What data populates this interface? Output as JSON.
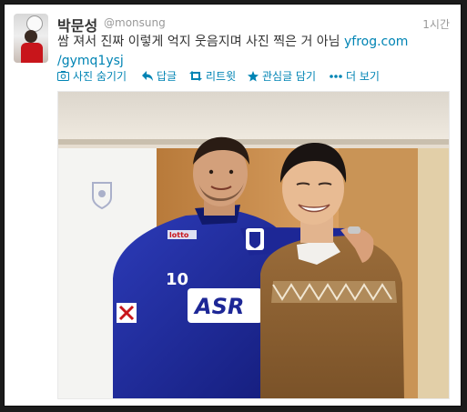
{
  "tweet": {
    "name": "박문성",
    "handle": "@monsung",
    "time": "1시간",
    "text": "쌈 져서 진짜 이렇게 억지 웃음지며 사진 찍은 거 아님 ",
    "link_part1": "yfrog.com",
    "link_part2": "/gymq1ysj"
  },
  "actions": {
    "hide_photo": "사진 숨기기",
    "reply": "답글",
    "retweet": "리트윗",
    "favorite": "관심글 담기",
    "more": "더 보기"
  },
  "photo": {
    "jersey_number": "10",
    "sponsor": "ASR",
    "kit_brand": "lotto"
  },
  "colors": {
    "link": "#0084b4",
    "text": "#333333",
    "meta": "#999999",
    "jersey": "#1f2a9c"
  }
}
